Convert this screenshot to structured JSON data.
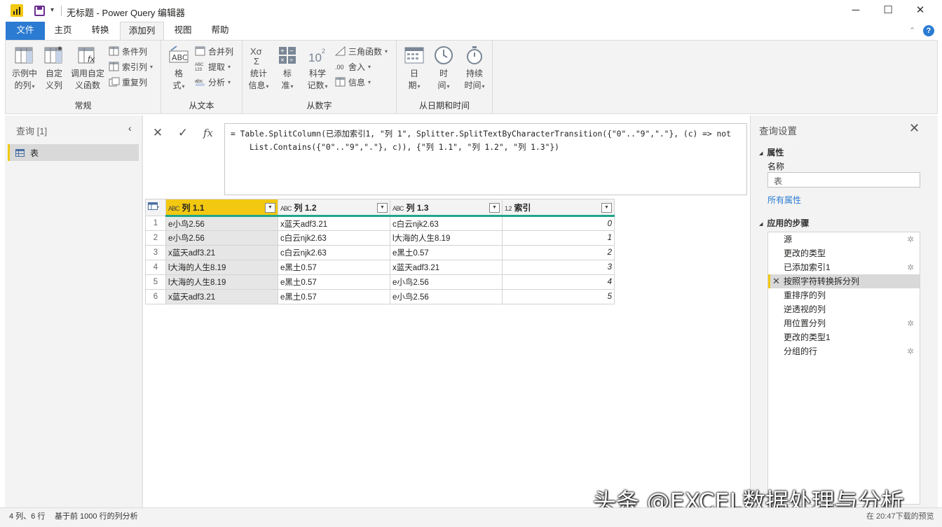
{
  "window": {
    "title": "无标题 - Power Query 编辑器",
    "minimize": "─",
    "maximize": "☐",
    "close": "✕"
  },
  "tabs": [
    {
      "label": "文件"
    },
    {
      "label": "主页"
    },
    {
      "label": "转换"
    },
    {
      "label": "添加列",
      "active": true
    },
    {
      "label": "视图"
    },
    {
      "label": "帮助"
    }
  ],
  "ribbon": {
    "groups": {
      "general": "常规",
      "from_text": "从文本",
      "from_number": "从数字",
      "from_datetime": "从日期和时间"
    },
    "buttons": {
      "example_col_1": "示例中",
      "example_col_2": "的列",
      "custom_col_1": "自定",
      "custom_col_2": "义列",
      "invoke_fn_1": "调用自定",
      "invoke_fn_2": "义函数",
      "conditional_col": "条件列",
      "index_col": "索引列",
      "duplicate_col": "重复列",
      "format_1": "格",
      "format_2": "式",
      "merge_cols": "合并列",
      "extract": "提取",
      "parse": "分析",
      "statistics_1": "统计",
      "statistics_2": "信息",
      "standard_1": "标",
      "standard_2": "准",
      "scientific_1": "科学",
      "scientific_2": "记数",
      "trig": "三角函数",
      "rounding": "舍入",
      "information": "信息",
      "date_1": "日",
      "date_2": "期",
      "time_1": "时",
      "time_2": "间",
      "duration_1": "持续",
      "duration_2": "时间"
    }
  },
  "queries": {
    "title": "查询 [1]",
    "items": [
      {
        "name": "表"
      }
    ]
  },
  "formula": {
    "line1": "= Table.SplitColumn(已添加索引1, \"列 1\", Splitter.SplitTextByCharacterTransition({\"0\"..\"9\",\".\"}, (c) => not",
    "line2": "List.Contains({\"0\"..\"9\",\".\"}, c)), {\"列 1.1\", \"列 1.2\", \"列 1.3\"})"
  },
  "grid": {
    "columns": [
      {
        "type": "ABC",
        "name": "列 1.1"
      },
      {
        "type": "ABC",
        "name": "列 1.2"
      },
      {
        "type": "ABC",
        "name": "列 1.3"
      },
      {
        "type": "1.2",
        "name": "索引"
      }
    ],
    "rows": [
      [
        "1",
        "e小鸟2.56",
        "x蓝天adf3.21",
        "c白云njk2.63",
        "0"
      ],
      [
        "2",
        "e小鸟2.56",
        "c白云njk2.63",
        "l大海的人生8.19",
        "1"
      ],
      [
        "3",
        "x蓝天adf3.21",
        "c白云njk2.63",
        "e黑土0.57",
        "2"
      ],
      [
        "4",
        "l大海的人生8.19",
        "e黑土0.57",
        "x蓝天adf3.21",
        "3"
      ],
      [
        "5",
        "l大海的人生8.19",
        "e黑土0.57",
        "e小鸟2.56",
        "4"
      ],
      [
        "6",
        "x蓝天adf3.21",
        "e黑土0.57",
        "e小鸟2.56",
        "5"
      ]
    ]
  },
  "settings": {
    "title": "查询设置",
    "properties_title": "属性",
    "name_label": "名称",
    "name_value": "表",
    "all_properties": "所有属性",
    "steps_title": "应用的步骤",
    "steps": [
      {
        "label": "源",
        "gear": true,
        "active": false
      },
      {
        "label": "更改的类型",
        "gear": false,
        "active": false
      },
      {
        "label": "已添加索引1",
        "gear": true,
        "active": false
      },
      {
        "label": "按照字符转换拆分列",
        "gear": false,
        "active": true
      },
      {
        "label": "重排序的列",
        "gear": false,
        "active": false
      },
      {
        "label": "逆透视的列",
        "gear": false,
        "active": false
      },
      {
        "label": "用位置分列",
        "gear": true,
        "active": false
      },
      {
        "label": "更改的类型1",
        "gear": false,
        "active": false
      },
      {
        "label": "分组的行",
        "gear": true,
        "active": false
      }
    ]
  },
  "status": {
    "left": "4 列、6 行",
    "mid": "基于前 1000 行的列分析",
    "right": "在 20:47下载的预览"
  },
  "watermark": "头条 @EXCEL数据处理与分析",
  "colors": {
    "accent_yellow": "#f2c811",
    "file_tab_blue": "#2b7bd2",
    "column_quality_green": "#1fa58b"
  }
}
